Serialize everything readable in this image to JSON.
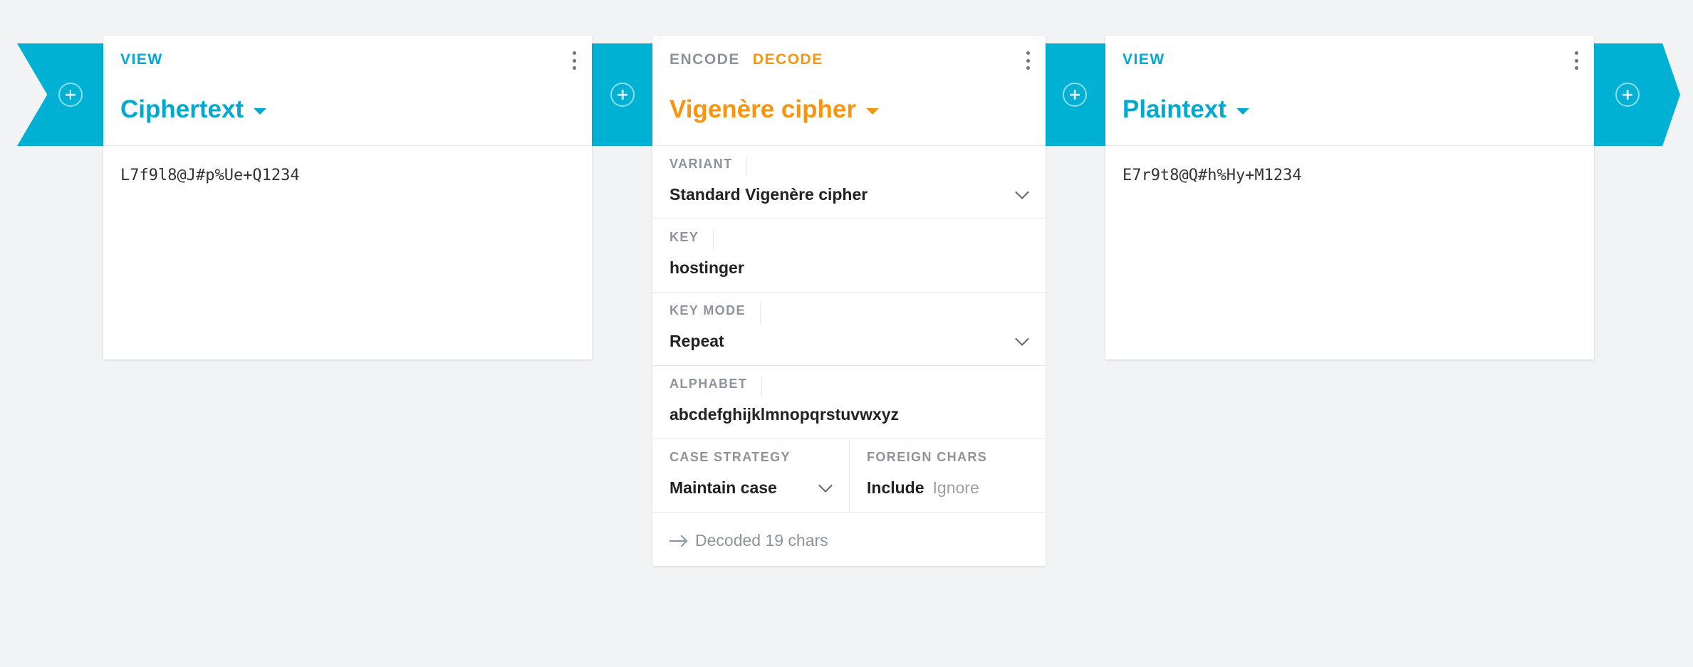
{
  "colors": {
    "accent_blue": "#00a9cf",
    "accent_orange": "#f7950e",
    "ribbon": "#00b1d4",
    "background": "#f2f3f5"
  },
  "view_left": {
    "tab_label": "VIEW",
    "title": "Ciphertext",
    "content": "L7f9l8@J#p%Ue+Q1234"
  },
  "cipher": {
    "tab_encode": "ENCODE",
    "tab_decode": "DECODE",
    "title": "Vigenère cipher",
    "variant_label": "VARIANT",
    "variant_value": "Standard Vigenère cipher",
    "key_label": "KEY",
    "key_value": "hostinger",
    "key_mode_label": "KEY MODE",
    "key_mode_value": "Repeat",
    "alphabet_label": "ALPHABET",
    "alphabet_value": "abcdefghijklmnopqrstuvwxyz",
    "case_label": "CASE STRATEGY",
    "case_value": "Maintain case",
    "foreign_label": "FOREIGN CHARS",
    "foreign_include": "Include",
    "foreign_ignore": "Ignore",
    "status": "Decoded 19 chars"
  },
  "view_right": {
    "tab_label": "VIEW",
    "title": "Plaintext",
    "content": "E7r9t8@Q#h%Hy+M1234"
  }
}
